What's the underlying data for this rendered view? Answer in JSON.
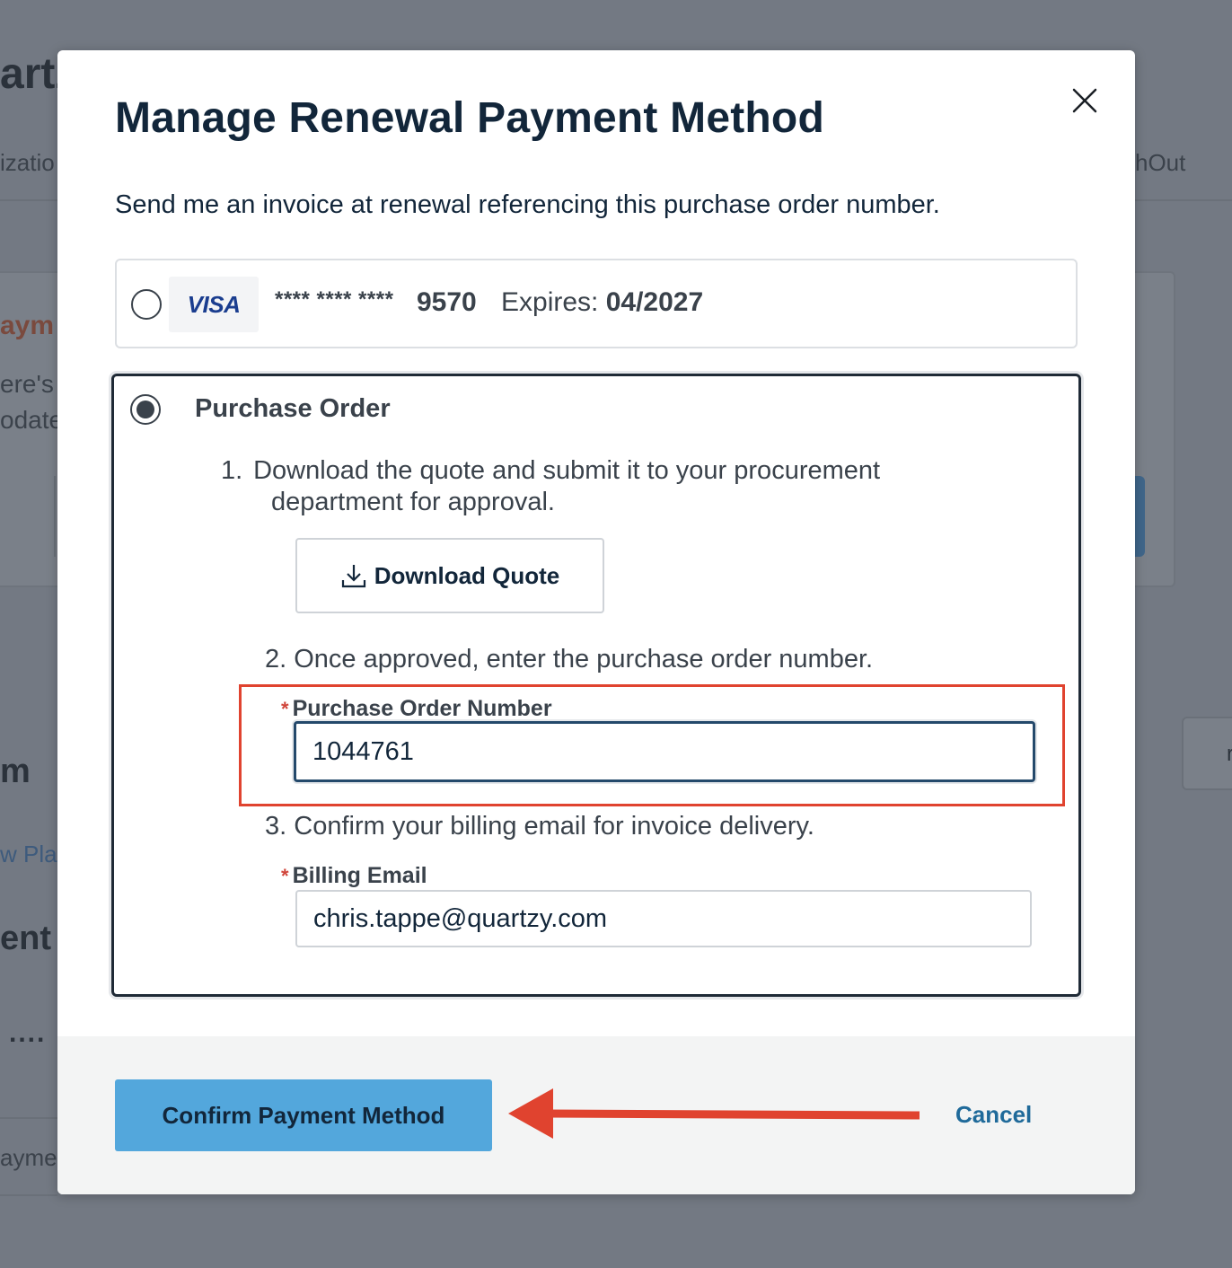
{
  "background": {
    "brand_fragment": "artz",
    "nav_left_fragment": "izatio",
    "nav_right_fragment": "hOut",
    "payment_fragment": "aym",
    "heres_fragment": "ere's",
    "update_fragment": "odate",
    "right_button_fragment": "r",
    "m_fragment": "m",
    "plan_fragment": "w Plan",
    "ent_fragment": "ent",
    "dots_fragment": "....",
    "payme_fragment": "ayme"
  },
  "modal": {
    "title": "Manage Renewal Payment Method",
    "subtitle": "Send me an invoice at renewal referencing this purchase order number.",
    "close_icon": "close-icon"
  },
  "visa_option": {
    "brand": "VISA",
    "masked": "**** **** ****",
    "last4": "9570",
    "expires_label": "Expires:",
    "expires_value": "04/2027",
    "selected": false
  },
  "po_option": {
    "label": "Purchase Order",
    "selected": true,
    "step1_num": "1.",
    "step1_text": "Download the quote and submit it to your procurement department for approval.",
    "download_label": "Download Quote",
    "download_icon": "download-icon",
    "step2_num": "2.",
    "step2_text": "Once approved, enter the purchase order number.",
    "po_field_label": "Purchase Order Number",
    "po_value": "1044761",
    "step3_num": "3.",
    "step3_text": "Confirm your billing email for invoice delivery.",
    "email_field_label": "Billing Email",
    "email_value": "chris.tappe@quartzy.com",
    "required_mark": "*"
  },
  "footer": {
    "confirm_label": "Confirm Payment Method",
    "cancel_label": "Cancel"
  },
  "colors": {
    "accent_button": "#53a7dc",
    "annotation_red": "#e0432f",
    "link_blue": "#1f6a9a",
    "text_dark": "#12263a"
  }
}
